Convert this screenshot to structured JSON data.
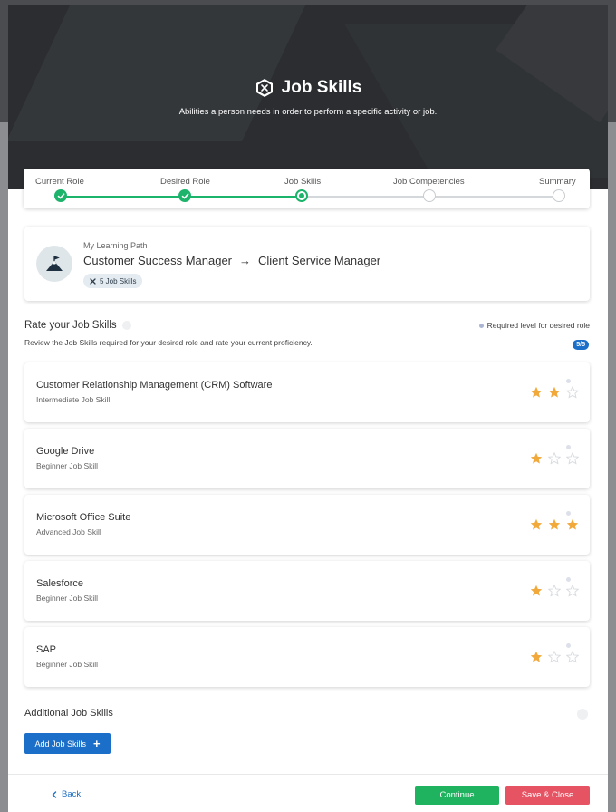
{
  "header": {
    "title": "Job Skills",
    "subtitle": "Abilities a person needs in order to perform a specific activity or job."
  },
  "stepper": {
    "steps": [
      {
        "label": "Current Role",
        "state": "done"
      },
      {
        "label": "Desired Role",
        "state": "done"
      },
      {
        "label": "Job Skills",
        "state": "current"
      },
      {
        "label": "Job Competencies",
        "state": "todo"
      },
      {
        "label": "Summary",
        "state": "todo"
      }
    ],
    "accent": "#1cb36a"
  },
  "learning_path": {
    "label": "My Learning Path",
    "current_role": "Customer Success Manager",
    "arrow": "→",
    "desired_role": "Client Service Manager",
    "badge": "5 Job Skills"
  },
  "rating": {
    "title": "Rate your Job Skills",
    "description": "Review the Job Skills required for your desired role and rate your current proficiency.",
    "legend": "Required level for desired role",
    "count": "5/5"
  },
  "skills": [
    {
      "name": "Customer Relationship Management (CRM) Software",
      "level": "Intermediate Job Skill",
      "rating": 2,
      "required": 2
    },
    {
      "name": "Google Drive",
      "level": "Beginner Job Skill",
      "rating": 1,
      "required": 2
    },
    {
      "name": "Microsoft Office Suite",
      "level": "Advanced Job Skill",
      "rating": 3,
      "required": 2
    },
    {
      "name": "Salesforce",
      "level": "Beginner Job Skill",
      "rating": 1,
      "required": 2
    },
    {
      "name": "SAP",
      "level": "Beginner Job Skill",
      "rating": 1,
      "required": 2
    }
  ],
  "additional": {
    "title": "Additional Job Skills",
    "add_button": "Add Job Skills",
    "add_icon": "+"
  },
  "footer": {
    "back": "Back",
    "continue": "Continue",
    "save_close": "Save & Close"
  },
  "colors": {
    "star_filled": "#f2a93b",
    "primary": "#1c6fc8",
    "continue": "#1fb35f",
    "save": "#e65464"
  }
}
